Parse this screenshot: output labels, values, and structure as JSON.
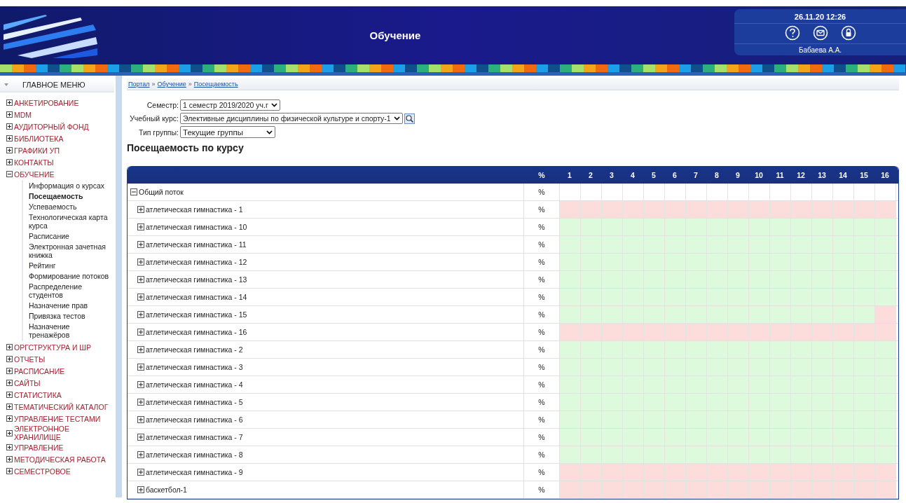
{
  "header": {
    "title": "Обучение",
    "datetime": "26.11.20 12:26",
    "user": "Бабаева А.А."
  },
  "sidebar": {
    "title": "ГЛАВНОЕ МЕНЮ",
    "items": [
      {
        "label": "АНКЕТИРОВАНИЕ",
        "expanded": false
      },
      {
        "label": "MDM",
        "expanded": false
      },
      {
        "label": "АУДИТОРНЫЙ ФОНД",
        "expanded": false
      },
      {
        "label": "БИБЛИОТЕКА",
        "expanded": false
      },
      {
        "label": "ГРАФИКИ УП",
        "expanded": false
      },
      {
        "label": "КОНТАКТЫ",
        "expanded": false
      },
      {
        "label": "ОБУЧЕНИЕ",
        "expanded": true,
        "children": [
          {
            "label": "Информация о курсах",
            "selected": false
          },
          {
            "label": "Посещаемость",
            "selected": true
          },
          {
            "label": "Успеваемость",
            "selected": false
          },
          {
            "label": "Технологическая карта курса",
            "selected": false
          },
          {
            "label": "Расписание",
            "selected": false
          },
          {
            "label": "Электронная зачетная книжка",
            "selected": false
          },
          {
            "label": "Рейтинг",
            "selected": false
          },
          {
            "label": "Формирование потоков",
            "selected": false
          },
          {
            "label": "Распределение студентов",
            "selected": false
          },
          {
            "label": "Назначение прав",
            "selected": false
          },
          {
            "label": "Привязка тестов",
            "selected": false
          },
          {
            "label": "Назначение тренажёров",
            "selected": false
          }
        ]
      },
      {
        "label": "ОРГСТРУКТУРА И ШР",
        "expanded": false
      },
      {
        "label": "ОТЧЕТЫ",
        "expanded": false
      },
      {
        "label": "РАСПИСАНИЕ",
        "expanded": false
      },
      {
        "label": "САЙТЫ",
        "expanded": false
      },
      {
        "label": "СТАТИСТИКА",
        "expanded": false
      },
      {
        "label": "ТЕМАТИЧЕСКИЙ КАТАЛОГ",
        "expanded": false
      },
      {
        "label": "УПРАВЛЕНИЕ ТЕСТАМИ",
        "expanded": false
      },
      {
        "label": "ЭЛЕКТРОННОЕ ХРАНИЛИЩЕ",
        "expanded": false
      },
      {
        "label": "УПРАВЛЕНИЕ",
        "expanded": false
      },
      {
        "label": "МЕТОДИЧЕСКАЯ РАБОТА",
        "expanded": false
      },
      {
        "label": "СЕМЕСТРОВОЕ",
        "expanded": false
      }
    ]
  },
  "breadcrumb": [
    "Портал",
    "Обучение",
    "Посещаемость"
  ],
  "breadcrumb_separators": [
    "»",
    "»"
  ],
  "filters": [
    {
      "label": "Семестр:",
      "value": "1 семестр 2019/2020 уч.г",
      "search": false
    },
    {
      "label": "Учебный курс:",
      "value": "Элективные дисциплины по физической культуре и спорту-1",
      "search": true
    },
    {
      "label": "Тип группы:",
      "value": "Текущие группы",
      "search": false
    }
  ],
  "heading": "Посещаемость по курсу",
  "table": {
    "columns": [
      "%",
      "1",
      "2",
      "3",
      "4",
      "5",
      "6",
      "7",
      "8",
      "9",
      "10",
      "11",
      "12",
      "13",
      "14",
      "15",
      "16"
    ],
    "rows": [
      {
        "name": "Общий поток",
        "percent": "%",
        "expanded": true,
        "cells": [
          {
            "color": "#ffffff"
          },
          {
            "color": "#ffffff"
          },
          {
            "color": "#ffffff"
          },
          {
            "color": "#ffffff"
          },
          {
            "color": "#ffffff"
          },
          {
            "color": "#ffffff"
          },
          {
            "color": "#ffffff"
          },
          {
            "color": "#ffffff"
          },
          {
            "color": "#ffffff"
          },
          {
            "color": "#ffffff"
          },
          {
            "color": "#ffffff"
          },
          {
            "color": "#ffffff"
          },
          {
            "color": "#ffffff"
          },
          {
            "color": "#ffffff"
          },
          {
            "color": "#ffffff"
          },
          {
            "color": "#ffffff"
          }
        ],
        "children": [
          {
            "name": "атлетическая гимнастика - 1",
            "percent": "%",
            "expanded": false,
            "cells": [
              {
                "color": "#fddcdc"
              },
              {
                "color": "#fddcdc"
              },
              {
                "color": "#fddcdc"
              },
              {
                "color": "#fddcdc"
              },
              {
                "color": "#fddcdc"
              },
              {
                "color": "#fddcdc"
              },
              {
                "color": "#fddcdc"
              },
              {
                "color": "#fddcdc"
              },
              {
                "color": "#fddcdc"
              },
              {
                "color": "#fddcdc"
              },
              {
                "color": "#fddcdc"
              },
              {
                "color": "#fddcdc"
              },
              {
                "color": "#fddcdc"
              },
              {
                "color": "#fddcdc"
              },
              {
                "color": "#fddcdc"
              },
              {
                "color": "#fddcdc"
              }
            ]
          },
          {
            "name": "атлетическая гимнастика - 10",
            "percent": "%",
            "expanded": false,
            "cells": [
              {
                "color": "#ddfadd"
              },
              {
                "color": "#ddfadd"
              },
              {
                "color": "#ddfadd"
              },
              {
                "color": "#ddfadd"
              },
              {
                "color": "#ddfadd"
              },
              {
                "color": "#ddfadd"
              },
              {
                "color": "#ddfadd"
              },
              {
                "color": "#ddfadd"
              },
              {
                "color": "#ddfadd"
              },
              {
                "color": "#ddfadd"
              },
              {
                "color": "#ddfadd"
              },
              {
                "color": "#ddfadd"
              },
              {
                "color": "#ddfadd"
              },
              {
                "color": "#ddfadd"
              },
              {
                "color": "#ddfadd"
              },
              {
                "color": "#ddfadd"
              }
            ]
          },
          {
            "name": "атлетическая гимнастика - 11",
            "percent": "%",
            "expanded": false,
            "cells": [
              {
                "color": "#ddfadd"
              },
              {
                "color": "#ddfadd"
              },
              {
                "color": "#ddfadd"
              },
              {
                "color": "#ddfadd"
              },
              {
                "color": "#ddfadd"
              },
              {
                "color": "#ddfadd"
              },
              {
                "color": "#ddfadd"
              },
              {
                "color": "#ddfadd"
              },
              {
                "color": "#ddfadd"
              },
              {
                "color": "#ddfadd"
              },
              {
                "color": "#ddfadd"
              },
              {
                "color": "#ddfadd"
              },
              {
                "color": "#ddfadd"
              },
              {
                "color": "#ddfadd"
              },
              {
                "color": "#ddfadd"
              },
              {
                "color": "#ddfadd"
              }
            ]
          },
          {
            "name": "атлетическая гимнастика - 12",
            "percent": "%",
            "expanded": false,
            "cells": [
              {
                "color": "#ddfadd"
              },
              {
                "color": "#ddfadd"
              },
              {
                "color": "#ddfadd"
              },
              {
                "color": "#ddfadd"
              },
              {
                "color": "#ddfadd"
              },
              {
                "color": "#ddfadd"
              },
              {
                "color": "#ddfadd"
              },
              {
                "color": "#ddfadd"
              },
              {
                "color": "#ddfadd"
              },
              {
                "color": "#ddfadd"
              },
              {
                "color": "#ddfadd"
              },
              {
                "color": "#ddfadd"
              },
              {
                "color": "#ddfadd"
              },
              {
                "color": "#ddfadd"
              },
              {
                "color": "#ddfadd"
              },
              {
                "color": "#ddfadd"
              }
            ]
          },
          {
            "name": "атлетическая гимнастика - 13",
            "percent": "%",
            "expanded": false,
            "cells": [
              {
                "color": "#ddfadd"
              },
              {
                "color": "#ddfadd"
              },
              {
                "color": "#ddfadd"
              },
              {
                "color": "#ddfadd"
              },
              {
                "color": "#ddfadd"
              },
              {
                "color": "#ddfadd"
              },
              {
                "color": "#ddfadd"
              },
              {
                "color": "#ddfadd"
              },
              {
                "color": "#ddfadd"
              },
              {
                "color": "#ddfadd"
              },
              {
                "color": "#ddfadd"
              },
              {
                "color": "#ddfadd"
              },
              {
                "color": "#ddfadd"
              },
              {
                "color": "#ddfadd"
              },
              {
                "color": "#ddfadd"
              },
              {
                "color": "#ddfadd"
              }
            ]
          },
          {
            "name": "атлетическая гимнастика - 14",
            "percent": "%",
            "expanded": false,
            "cells": [
              {
                "color": "#ddfadd"
              },
              {
                "color": "#ddfadd"
              },
              {
                "color": "#ddfadd"
              },
              {
                "color": "#ddfadd"
              },
              {
                "color": "#ddfadd"
              },
              {
                "color": "#ddfadd"
              },
              {
                "color": "#ddfadd"
              },
              {
                "color": "#ddfadd"
              },
              {
                "color": "#ddfadd"
              },
              {
                "color": "#ddfadd"
              },
              {
                "color": "#ddfadd"
              },
              {
                "color": "#ddfadd"
              },
              {
                "color": "#ddfadd"
              },
              {
                "color": "#ddfadd"
              },
              {
                "color": "#ddfadd"
              },
              {
                "color": "#ddfadd"
              }
            ]
          },
          {
            "name": "атлетическая гимнастика - 15",
            "percent": "%",
            "expanded": false,
            "cells": [
              {
                "color": "#ddfadd"
              },
              {
                "color": "#ddfadd"
              },
              {
                "color": "#ddfadd"
              },
              {
                "color": "#ddfadd"
              },
              {
                "color": "#ddfadd"
              },
              {
                "color": "#ddfadd"
              },
              {
                "color": "#ddfadd"
              },
              {
                "color": "#ddfadd"
              },
              {
                "color": "#ddfadd"
              },
              {
                "color": "#ddfadd"
              },
              {
                "color": "#ddfadd"
              },
              {
                "color": "#ddfadd"
              },
              {
                "color": "#ddfadd"
              },
              {
                "color": "#ddfadd"
              },
              {
                "color": "#ddfadd"
              },
              {
                "color": "#fddcdc"
              }
            ]
          },
          {
            "name": "атлетическая гимнастика - 16",
            "percent": "%",
            "expanded": false,
            "cells": [
              {
                "color": "#fddcdc"
              },
              {
                "color": "#fddcdc"
              },
              {
                "color": "#fddcdc"
              },
              {
                "color": "#fddcdc"
              },
              {
                "color": "#fddcdc"
              },
              {
                "color": "#fddcdc"
              },
              {
                "color": "#fddcdc"
              },
              {
                "color": "#fddcdc"
              },
              {
                "color": "#fddcdc"
              },
              {
                "color": "#fddcdc"
              },
              {
                "color": "#fddcdc"
              },
              {
                "color": "#fddcdc"
              },
              {
                "color": "#fddcdc"
              },
              {
                "color": "#fddcdc"
              },
              {
                "color": "#fddcdc"
              },
              {
                "color": "#fddcdc"
              }
            ]
          },
          {
            "name": "атлетическая гимнастика - 2",
            "percent": "%",
            "expanded": false,
            "cells": [
              {
                "color": "#ddfadd"
              },
              {
                "color": "#ddfadd"
              },
              {
                "color": "#ddfadd"
              },
              {
                "color": "#ddfadd"
              },
              {
                "color": "#ddfadd"
              },
              {
                "color": "#ddfadd"
              },
              {
                "color": "#ddfadd"
              },
              {
                "color": "#ddfadd"
              },
              {
                "color": "#ddfadd"
              },
              {
                "color": "#ddfadd"
              },
              {
                "color": "#ddfadd"
              },
              {
                "color": "#ddfadd"
              },
              {
                "color": "#ddfadd"
              },
              {
                "color": "#ddfadd"
              },
              {
                "color": "#ddfadd"
              },
              {
                "color": "#ddfadd"
              }
            ]
          },
          {
            "name": "атлетическая гимнастика - 3",
            "percent": "%",
            "expanded": false,
            "cells": [
              {
                "color": "#ddfadd"
              },
              {
                "color": "#ddfadd"
              },
              {
                "color": "#ddfadd"
              },
              {
                "color": "#ddfadd"
              },
              {
                "color": "#ddfadd"
              },
              {
                "color": "#ddfadd"
              },
              {
                "color": "#ddfadd"
              },
              {
                "color": "#ddfadd"
              },
              {
                "color": "#ddfadd"
              },
              {
                "color": "#ddfadd"
              },
              {
                "color": "#ddfadd"
              },
              {
                "color": "#ddfadd"
              },
              {
                "color": "#ddfadd"
              },
              {
                "color": "#ddfadd"
              },
              {
                "color": "#ddfadd"
              },
              {
                "color": "#ddfadd"
              }
            ]
          },
          {
            "name": "атлетическая гимнастика - 4",
            "percent": "%",
            "expanded": false,
            "cells": [
              {
                "color": "#ddfadd"
              },
              {
                "color": "#ddfadd"
              },
              {
                "color": "#ddfadd"
              },
              {
                "color": "#ddfadd"
              },
              {
                "color": "#ddfadd"
              },
              {
                "color": "#ddfadd"
              },
              {
                "color": "#ddfadd"
              },
              {
                "color": "#ddfadd"
              },
              {
                "color": "#ddfadd"
              },
              {
                "color": "#ddfadd"
              },
              {
                "color": "#ddfadd"
              },
              {
                "color": "#ddfadd"
              },
              {
                "color": "#ddfadd"
              },
              {
                "color": "#ddfadd"
              },
              {
                "color": "#ddfadd"
              },
              {
                "color": "#ddfadd"
              }
            ]
          },
          {
            "name": "атлетическая гимнастика - 5",
            "percent": "%",
            "expanded": false,
            "cells": [
              {
                "color": "#ddfadd"
              },
              {
                "color": "#ddfadd"
              },
              {
                "color": "#ddfadd"
              },
              {
                "color": "#ddfadd"
              },
              {
                "color": "#ddfadd"
              },
              {
                "color": "#ddfadd"
              },
              {
                "color": "#ddfadd"
              },
              {
                "color": "#ddfadd"
              },
              {
                "color": "#ddfadd"
              },
              {
                "color": "#ddfadd"
              },
              {
                "color": "#ddfadd"
              },
              {
                "color": "#ddfadd"
              },
              {
                "color": "#ddfadd"
              },
              {
                "color": "#ddfadd"
              },
              {
                "color": "#ddfadd"
              },
              {
                "color": "#ddfadd"
              }
            ]
          },
          {
            "name": "атлетическая гимнастика - 6",
            "percent": "%",
            "expanded": false,
            "cells": [
              {
                "color": "#ddfadd"
              },
              {
                "color": "#ddfadd"
              },
              {
                "color": "#ddfadd"
              },
              {
                "color": "#ddfadd"
              },
              {
                "color": "#ddfadd"
              },
              {
                "color": "#ddfadd"
              },
              {
                "color": "#ddfadd"
              },
              {
                "color": "#ddfadd"
              },
              {
                "color": "#ddfadd"
              },
              {
                "color": "#ddfadd"
              },
              {
                "color": "#ddfadd"
              },
              {
                "color": "#ddfadd"
              },
              {
                "color": "#ddfadd"
              },
              {
                "color": "#ddfadd"
              },
              {
                "color": "#ddfadd"
              },
              {
                "color": "#ddfadd"
              }
            ]
          },
          {
            "name": "атлетическая гимнастика - 7",
            "percent": "%",
            "expanded": false,
            "cells": [
              {
                "color": "#ddfadd"
              },
              {
                "color": "#ddfadd"
              },
              {
                "color": "#ddfadd"
              },
              {
                "color": "#ddfadd"
              },
              {
                "color": "#ddfadd"
              },
              {
                "color": "#ddfadd"
              },
              {
                "color": "#ddfadd"
              },
              {
                "color": "#ddfadd"
              },
              {
                "color": "#ddfadd"
              },
              {
                "color": "#ddfadd"
              },
              {
                "color": "#ddfadd"
              },
              {
                "color": "#ddfadd"
              },
              {
                "color": "#ddfadd"
              },
              {
                "color": "#ddfadd"
              },
              {
                "color": "#ddfadd"
              },
              {
                "color": "#ddfadd"
              }
            ]
          },
          {
            "name": "атлетическая гимнастика - 8",
            "percent": "%",
            "expanded": false,
            "cells": [
              {
                "color": "#ddfadd"
              },
              {
                "color": "#ddfadd"
              },
              {
                "color": "#ddfadd"
              },
              {
                "color": "#ddfadd"
              },
              {
                "color": "#ddfadd"
              },
              {
                "color": "#ddfadd"
              },
              {
                "color": "#ddfadd"
              },
              {
                "color": "#ddfadd"
              },
              {
                "color": "#ddfadd"
              },
              {
                "color": "#ddfadd"
              },
              {
                "color": "#ddfadd"
              },
              {
                "color": "#ddfadd"
              },
              {
                "color": "#ddfadd"
              },
              {
                "color": "#ddfadd"
              },
              {
                "color": "#ddfadd"
              },
              {
                "color": "#ddfadd"
              }
            ]
          },
          {
            "name": "атлетическая гимнастика - 9",
            "percent": "%",
            "expanded": false,
            "cells": [
              {
                "color": "#fddcdc"
              },
              {
                "color": "#fddcdc"
              },
              {
                "color": "#fddcdc"
              },
              {
                "color": "#fddcdc"
              },
              {
                "color": "#fddcdc"
              },
              {
                "color": "#fddcdc"
              },
              {
                "color": "#fddcdc"
              },
              {
                "color": "#fddcdc"
              },
              {
                "color": "#fddcdc"
              },
              {
                "color": "#fddcdc"
              },
              {
                "color": "#fddcdc"
              },
              {
                "color": "#fddcdc"
              },
              {
                "color": "#fddcdc"
              },
              {
                "color": "#fddcdc"
              },
              {
                "color": "#fddcdc"
              },
              {
                "color": "#fddcdc"
              }
            ]
          },
          {
            "name": "баскетбол-1",
            "percent": "%",
            "expanded": false,
            "cells": [
              {
                "color": "#fddcdc"
              },
              {
                "color": "#fddcdc"
              },
              {
                "color": "#fddcdc"
              },
              {
                "color": "#fddcdc"
              },
              {
                "color": "#fddcdc"
              },
              {
                "color": "#fddcdc"
              },
              {
                "color": "#fddcdc"
              },
              {
                "color": "#fddcdc"
              },
              {
                "color": "#fddcdc"
              },
              {
                "color": "#fddcdc"
              },
              {
                "color": "#fddcdc"
              },
              {
                "color": "#fddcdc"
              },
              {
                "color": "#fddcdc"
              },
              {
                "color": "#fddcdc"
              },
              {
                "color": "#fddcdc"
              },
              {
                "color": "#fddcdc"
              }
            ]
          }
        ]
      }
    ]
  }
}
